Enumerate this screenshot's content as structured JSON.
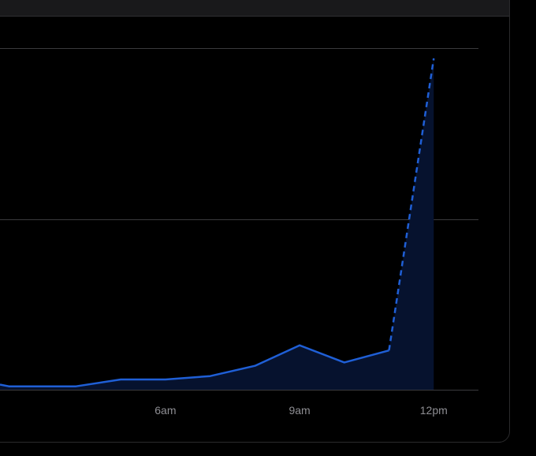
{
  "colors": {
    "background": "#000000",
    "panel_border": "#2a2a2c",
    "header": "#19191b",
    "grid": "#3a3a3d",
    "line": "#1f5fd6",
    "area": "#06122e",
    "tick_text": "#8e8e93"
  },
  "chart_data": {
    "type": "line",
    "x_unit": "hour",
    "x_ticks": [
      {
        "x": 6,
        "label": "6am"
      },
      {
        "x": 9,
        "label": "9am"
      },
      {
        "x": 12,
        "label": "12pm"
      }
    ],
    "xlim": [
      2.3,
      13.0
    ],
    "ylim": [
      0,
      2
    ],
    "y_gridlines": [
      0,
      1,
      2
    ],
    "series": [
      {
        "style": "solid",
        "points": [
          [
            2.3,
            0.03
          ],
          [
            2.5,
            0.02
          ],
          [
            3.0,
            0.02
          ],
          [
            4.0,
            0.02
          ],
          [
            5.0,
            0.06
          ],
          [
            6.0,
            0.06
          ],
          [
            7.0,
            0.08
          ],
          [
            8.0,
            0.14
          ],
          [
            9.0,
            0.26
          ],
          [
            10.0,
            0.16
          ],
          [
            11.0,
            0.23
          ]
        ]
      },
      {
        "style": "dashed",
        "points": [
          [
            11.0,
            0.23
          ],
          [
            12.0,
            1.94
          ]
        ]
      }
    ],
    "area_fill": true,
    "grid": true,
    "legend": "none"
  }
}
